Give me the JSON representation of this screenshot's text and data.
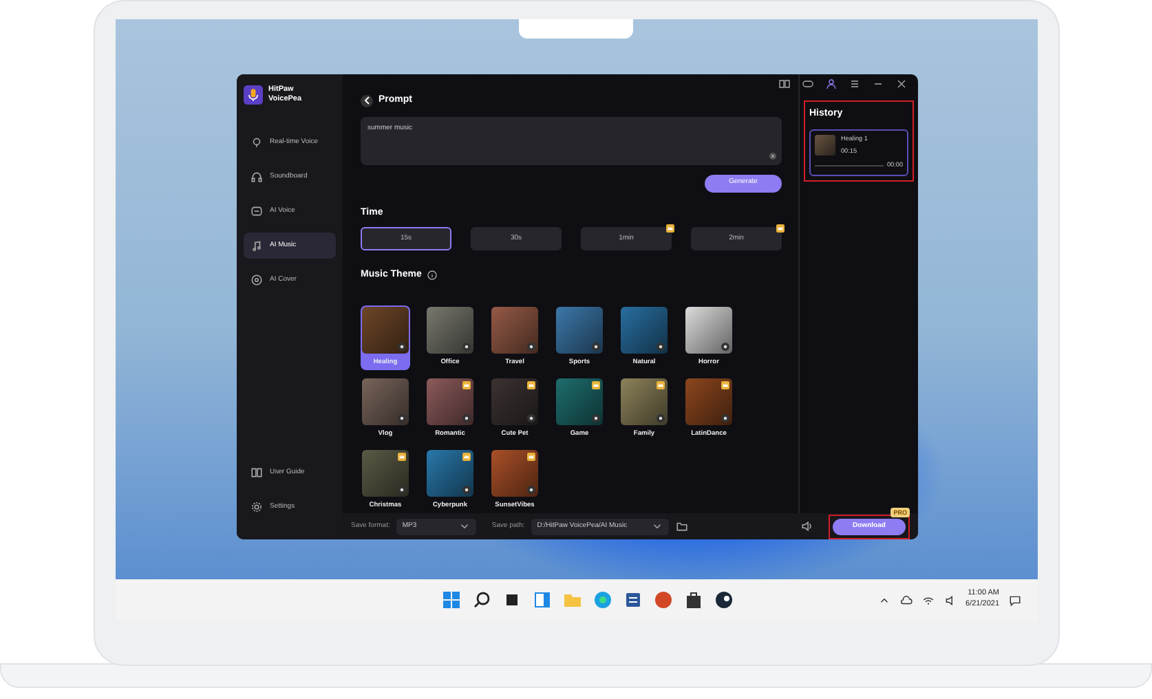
{
  "app": {
    "name": "HitPaw VoicePea"
  },
  "sidebar": {
    "items": [
      {
        "label": "Real-time Voice",
        "selected": false
      },
      {
        "label": "Soundboard",
        "selected": false
      },
      {
        "label": "AI Voice",
        "selected": false
      },
      {
        "label": "AI Music",
        "selected": true
      },
      {
        "label": "AI Cover",
        "selected": false
      }
    ],
    "footer_items": [
      {
        "label": "User Guide"
      },
      {
        "label": "Settings"
      }
    ]
  },
  "prompt": {
    "title": "Prompt",
    "value": "summer music",
    "button": "Generate"
  },
  "time": {
    "title": "Time",
    "options": [
      {
        "label": "15s",
        "selected": true,
        "pro": false
      },
      {
        "label": "30s",
        "selected": false,
        "pro": false
      },
      {
        "label": "1min",
        "selected": false,
        "pro": true
      },
      {
        "label": "2min",
        "selected": false,
        "pro": true
      }
    ]
  },
  "music_theme": {
    "title": "Music Theme",
    "themes": [
      {
        "name": "Healing",
        "selected": true,
        "pro": false
      },
      {
        "name": "Office",
        "selected": false,
        "pro": false
      },
      {
        "name": "Travel",
        "selected": false,
        "pro": false
      },
      {
        "name": "Sports",
        "selected": false,
        "pro": false
      },
      {
        "name": "Natural",
        "selected": false,
        "pro": false
      },
      {
        "name": "Horror",
        "selected": false,
        "pro": false
      },
      {
        "name": "Vlog",
        "selected": false,
        "pro": false
      },
      {
        "name": "Romantic",
        "selected": false,
        "pro": true
      },
      {
        "name": "Cute Pet",
        "selected": false,
        "pro": true
      },
      {
        "name": "Game",
        "selected": false,
        "pro": true
      },
      {
        "name": "Family",
        "selected": false,
        "pro": true
      },
      {
        "name": "LatinDance",
        "selected": false,
        "pro": true
      },
      {
        "name": "Christmas",
        "selected": false,
        "pro": true
      },
      {
        "name": "Cyberpunk",
        "selected": false,
        "pro": true
      },
      {
        "name": "SunsetVibes",
        "selected": false,
        "pro": true
      }
    ]
  },
  "history": {
    "title": "History",
    "highlighted": true,
    "items": [
      {
        "title": "Healing 1",
        "duration": "00:15",
        "position": "00:00"
      }
    ]
  },
  "bottom_bar": {
    "save_format_label": "Save format:",
    "save_format": "MP3",
    "save_path_label": "Save path:",
    "save_path": "D:/HitPaw VoicePea/AI Music",
    "download": {
      "label": "Download",
      "badge": "PRO",
      "highlighted": true
    }
  },
  "taskbar": {
    "time": "11:00 AM",
    "date": "6/21/2021"
  }
}
